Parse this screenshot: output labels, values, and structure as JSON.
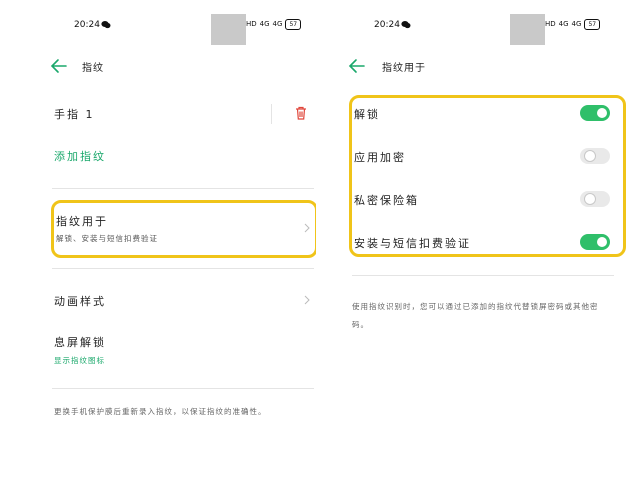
{
  "status_bar": {
    "time": "20:24",
    "network": "HD",
    "signal1": "4G",
    "signal2": "4G",
    "battery": "57"
  },
  "left": {
    "title": "指纹",
    "finger_1": "手指 1",
    "add_fingerprint": "添加指纹",
    "fingerprint_usage": {
      "title": "指纹用于",
      "subtitle": "解锁、安装与短信扣费验证"
    },
    "animation_style": "动画样式",
    "screen_off_unlock": {
      "title": "息屏解锁",
      "subtitle": "显示指纹图标"
    },
    "footer": "更换手机保护膜后重新录入指纹，以保证指纹的准确性。"
  },
  "right": {
    "title": "指纹用于",
    "options": [
      {
        "label": "解锁",
        "enabled": true
      },
      {
        "label": "应用加密",
        "enabled": false
      },
      {
        "label": "私密保险箱",
        "enabled": false
      },
      {
        "label": "安装与短信扣费验证",
        "enabled": true
      }
    ],
    "footer": "使用指纹识别时，您可以通过已添加的指纹代替锁屏密码或其他密码。"
  },
  "colors": {
    "accent_green": "#1aa86b",
    "toggle_on": "#2fbf6a",
    "highlight_yellow": "#f0c419",
    "delete_red": "#e0453a"
  },
  "icons": {
    "back": "back-arrow-icon",
    "delete": "trash-icon",
    "chevron": "chevron-right-icon",
    "wechat": "wechat-icon"
  }
}
